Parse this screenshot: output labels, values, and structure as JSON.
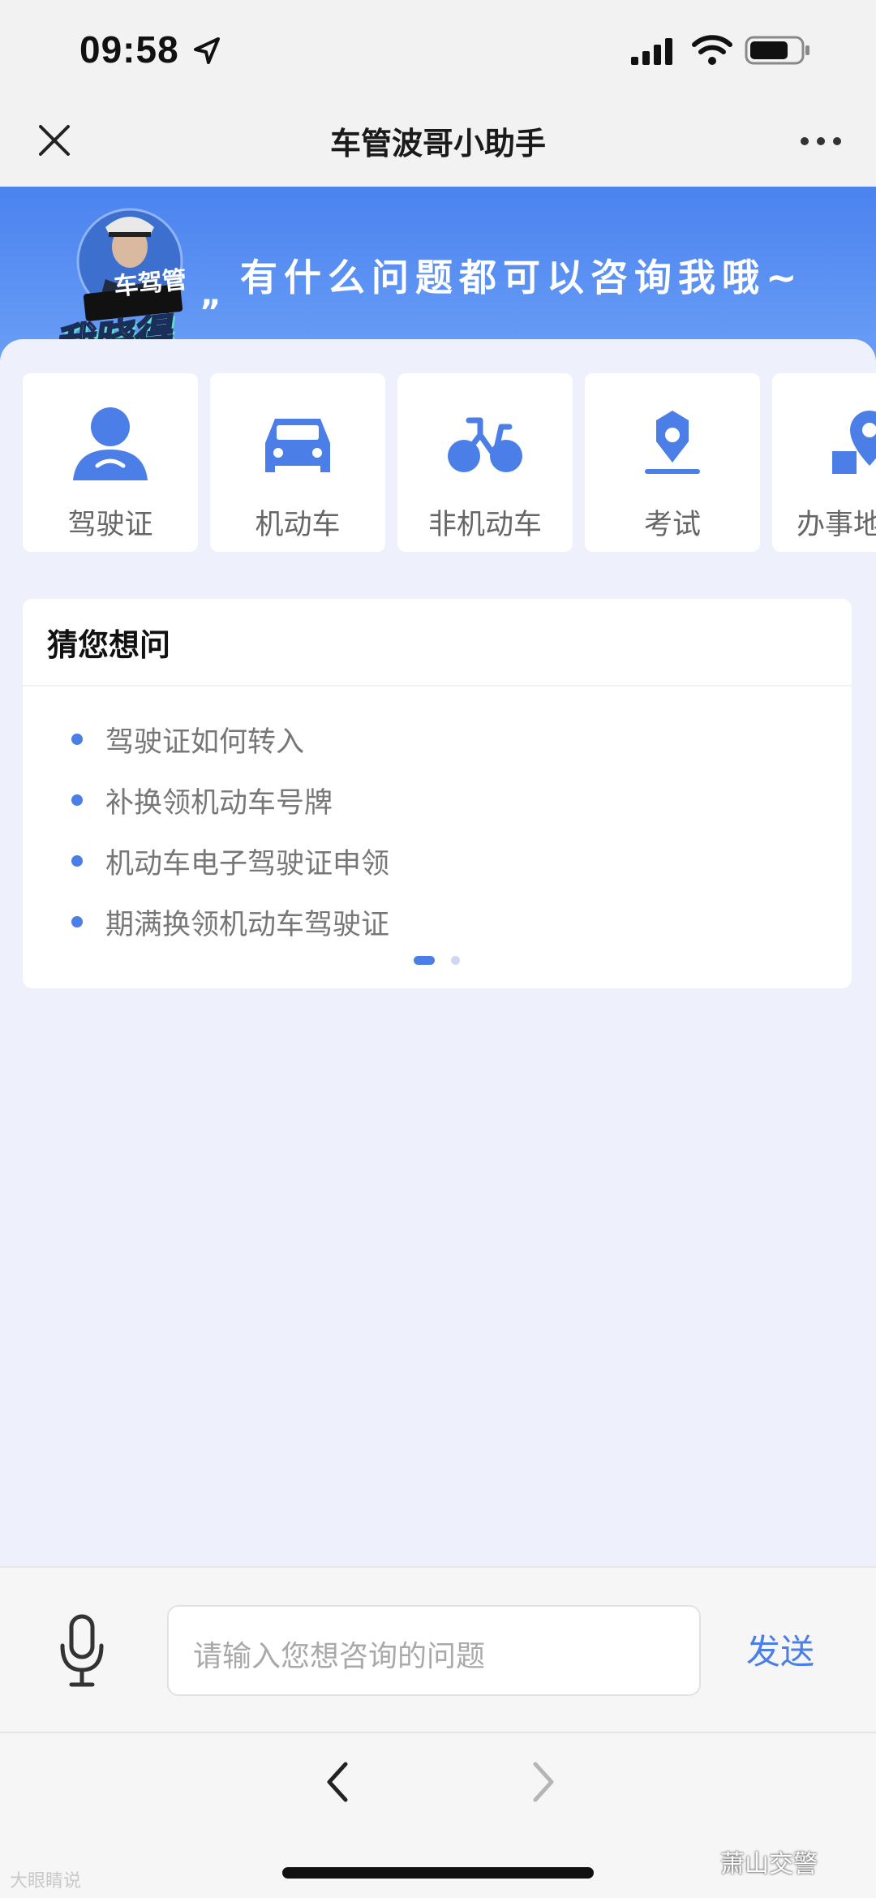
{
  "status_bar": {
    "time": "09:58",
    "icons": [
      "location-arrow-icon",
      "cellular-signal-icon",
      "wifi-icon",
      "battery-icon"
    ]
  },
  "nav": {
    "title": "车管波哥小助手",
    "close_icon": "close-icon",
    "more_icon": "more-icon"
  },
  "banner": {
    "slogan": "有什么问题都可以咨询我哦~",
    "avatar_badge_top": "车驾管",
    "avatar_badge_bottom": "我晓得"
  },
  "categories": [
    {
      "label": "驾驶证",
      "icon": "person-icon"
    },
    {
      "label": "机动车",
      "icon": "car-icon"
    },
    {
      "label": "非机动车",
      "icon": "bicycle-icon"
    },
    {
      "label": "考试",
      "icon": "location-pin-icon"
    },
    {
      "label": "办事地",
      "icon": "map-pin-icon"
    }
  ],
  "guess": {
    "title": "猜您想问",
    "items": [
      "驾驶证如何转入",
      "补换领机动车号牌",
      "机动车电子驾驶证申领",
      "期满换领机动车驾驶证"
    ],
    "pages": 2,
    "current_page": 1
  },
  "input": {
    "placeholder": "请输入您想咨询的问题",
    "send_label": "发送",
    "mic_icon": "microphone-icon"
  },
  "browser_nav": {
    "back_icon": "chevron-left-icon",
    "forward_icon": "chevron-right-icon"
  },
  "watermarks": {
    "left": "大眼睛说",
    "right": "萧山交警"
  },
  "colors": {
    "accent": "#4c7ee8",
    "banner_top": "#4b83ef",
    "banner_bottom": "#6a9ef6",
    "page_bg": "#eef1fb"
  }
}
